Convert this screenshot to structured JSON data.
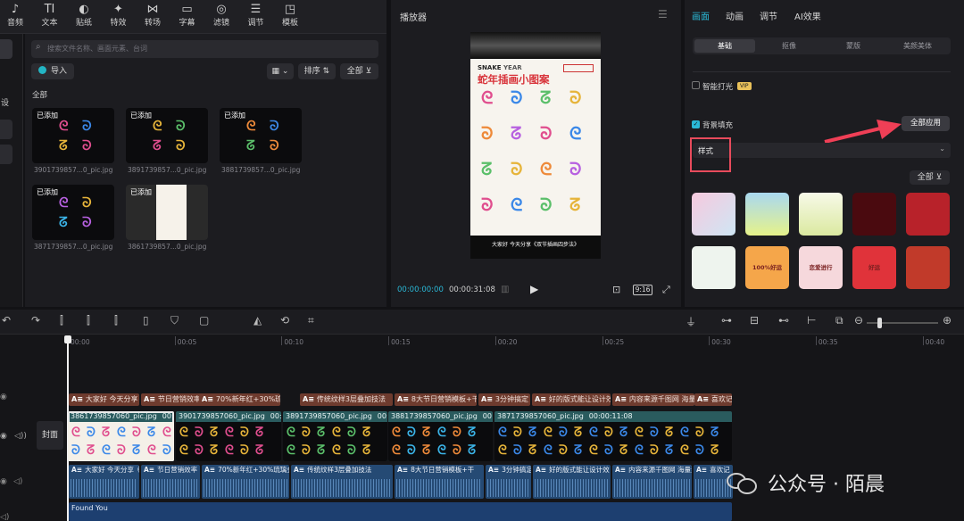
{
  "toolbar": {
    "items": [
      {
        "label": "音频",
        "icon": "audio-icon",
        "glyph": "♪"
      },
      {
        "label": "文本",
        "icon": "text-icon",
        "glyph": "TI"
      },
      {
        "label": "贴纸",
        "icon": "sticker-icon",
        "glyph": "◐"
      },
      {
        "label": "特效",
        "icon": "effects-icon",
        "glyph": "✦"
      },
      {
        "label": "转场",
        "icon": "transition-icon",
        "glyph": "⋈"
      },
      {
        "label": "字幕",
        "icon": "subtitle-icon",
        "glyph": "▭"
      },
      {
        "label": "滤镜",
        "icon": "filter-icon",
        "glyph": "◎"
      },
      {
        "label": "调节",
        "icon": "adjust-icon",
        "glyph": "☰"
      },
      {
        "label": "模板",
        "icon": "template-icon",
        "glyph": "◳"
      }
    ]
  },
  "library": {
    "search_placeholder": "搜索文件名称、画面元素、台词",
    "import_label": "导入",
    "sort_label": "排序",
    "filter_label": "全部",
    "section_label": "全部",
    "side_labels": [
      "设"
    ],
    "items": [
      {
        "added": "已添加",
        "name": "3901739857...0_pic.jpg"
      },
      {
        "added": "已添加",
        "name": "3891739857...0_pic.jpg"
      },
      {
        "added": "已添加",
        "name": "3881739857...0_pic.jpg"
      },
      {
        "added": "已添加",
        "name": "3871739857...0_pic.jpg"
      },
      {
        "added": "已添加",
        "name": "3861739857...0_pic.jpg"
      }
    ]
  },
  "player": {
    "title": "播放器",
    "current_time": "00:00:00:00",
    "total_time": "00:00:31:08",
    "ratio": "9:16",
    "poster": {
      "brand": "SNAKE",
      "year_label": "YEAR",
      "title": "蛇年插画小图案",
      "subtitle": "大家好 今天分享《双节插画四步法》"
    }
  },
  "inspector": {
    "tabs": [
      "画面",
      "动画",
      "调节",
      "AI效果"
    ],
    "subtabs": [
      "基础",
      "抠像",
      "蒙版",
      "美颜美体"
    ],
    "smart_light": "智能打光",
    "vip_badge": "VIP",
    "bg_fill": "背景填充",
    "apply_all": "全部应用",
    "style_label": "样式",
    "filter_all": "全部",
    "swatches_row1": [
      "#f2d6e6",
      "#d9e9a8",
      "#e8f0c2",
      "#4a0a0f",
      "#b8222a"
    ],
    "swatches_row2": [
      "#eef4ee",
      "#f5a64a",
      "#f6d8dc",
      "#e0333a",
      "#c13a2a"
    ],
    "swatch_labels": [
      "100%好运",
      "恋爱进行",
      "好运"
    ]
  },
  "timeline": {
    "ruler_ticks": [
      "00:00",
      "00:05",
      "00:10",
      "00:15",
      "00:20",
      "00:25",
      "00:30",
      "00:35",
      "00:40"
    ],
    "cover_label": "封面",
    "text_clips": [
      "大家好 今天分享",
      "节日营销效率",
      "70%新年红+30%琉璃金 吸睛率",
      "传统纹样3层叠加技法",
      "8大节日营销模板+干",
      "3分钟搞定",
      "好的版式能让设计效",
      "内容来源千图网 海量",
      "喜欢记"
    ],
    "video_clips": [
      {
        "name": "3861739857060_pic.jpg",
        "dur": "00:00"
      },
      {
        "name": "3901739857060_pic.jpg",
        "dur": "00:00"
      },
      {
        "name": "3891739857060_pic.jpg",
        "dur": "00:0"
      },
      {
        "name": "3881739857060_pic.jpg",
        "dur": "00"
      },
      {
        "name": "3871739857060_pic.jpg",
        "dur": "00:00:11:08"
      }
    ],
    "audio_clips": [
      "大家好 今天分享《",
      "节日营销效率",
      "70%新年红+30%琉璃金 吸睛率",
      "传统纹样3层叠加技法",
      "8大节日营销模板+干",
      "3分钟搞定热",
      "好的版式能让设计效",
      "内容来源千图网 海量素",
      "喜欢记"
    ],
    "music_label": "Found You",
    "watermark": "公众号 · 陌晨"
  }
}
